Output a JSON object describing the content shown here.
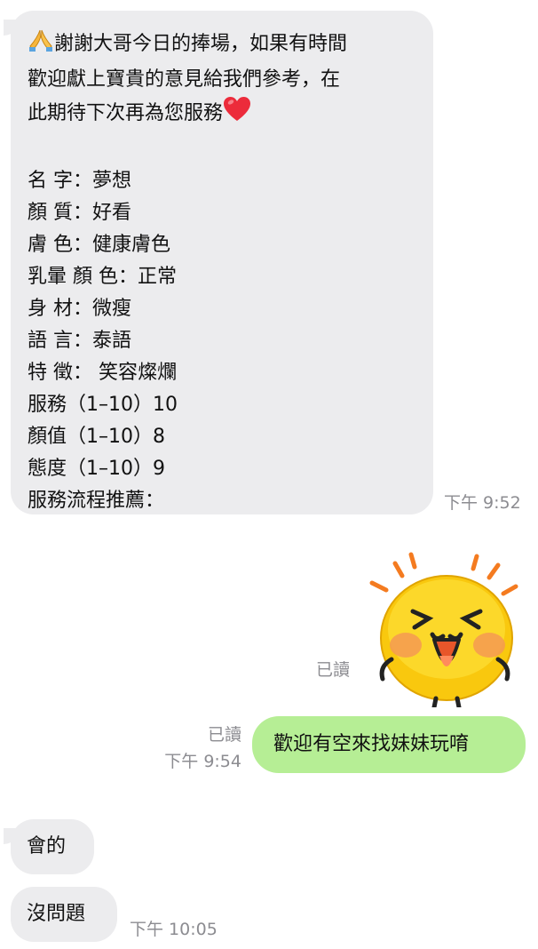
{
  "messages": {
    "review": {
      "lines": [
        "謝謝大哥今日的捧場，如果有時間",
        "歡迎獻上寶貴的意見給我們參考，在",
        "此期待下次再為您服務",
        "",
        "名 字：夢想",
        "顏 質：好看",
        "膚 色：健康膚色",
        "乳暈 顏 色：正常",
        "身 材：微瘦",
        "語 言：泰語",
        "特 徵： 笑容燦爛",
        "服務（1–10）10",
        "顏值（1–10）8",
        "態度（1–10）9",
        "服務流程推薦："
      ],
      "prefix_emoji": "folded-hands-icon",
      "suffix_emoji": "red-heart-icon",
      "time": "下午 9:52"
    },
    "sticker": {
      "icon": "laughing-face-sticker-icon",
      "read": "已讀"
    },
    "outgoing": {
      "text": "歡迎有空來找妹妹玩唷",
      "read": "已讀",
      "time": "下午 9:54"
    },
    "reply1": {
      "text": "會的"
    },
    "reply2": {
      "text": "沒問題",
      "time": "下午 10:05"
    }
  },
  "colors": {
    "incoming_bubble": "#ececee",
    "outgoing_bubble": "#b6ee95",
    "meta_text": "#8c8c91"
  }
}
